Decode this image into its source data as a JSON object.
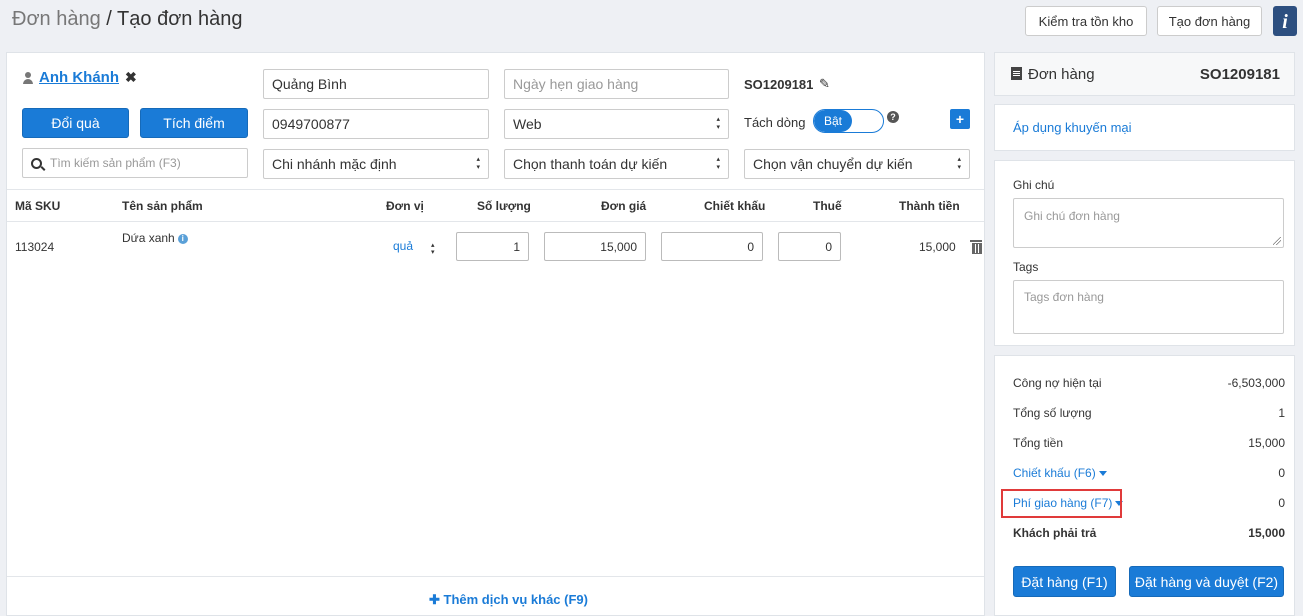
{
  "header": {
    "crumb_parent": "Đơn hàng",
    "crumb_separator": " / ",
    "crumb_current": "Tạo đơn hàng",
    "btn_check_stock": "Kiểm tra tồn kho",
    "btn_create_order": "Tạo đơn hàng",
    "info_glyph": "i"
  },
  "customer": {
    "name": "Anh Khánh",
    "remove_glyph": "✖"
  },
  "buttons": {
    "gift": "Đổi quà",
    "points": "Tích điểm"
  },
  "search": {
    "placeholder": "Tìm kiếm sản phẩm (F3)"
  },
  "fields": {
    "address": "Quảng Bình",
    "phone": "0949700877",
    "branch": "Chi nhánh mặc định",
    "delivery_date_placeholder": "Ngày hẹn giao hàng",
    "source": "Web",
    "payment": "Chọn thanh toán dự kiến",
    "shipping": "Chọn vận chuyển dự kiến"
  },
  "order": {
    "code": "SO1209181",
    "split_label": "Tách dòng",
    "split_state": "Bật",
    "help_glyph": "?",
    "add_glyph": "+"
  },
  "table": {
    "headers": {
      "sku": "Mã SKU",
      "name": "Tên sản phẩm",
      "unit": "Đơn vị",
      "qty": "Số lượng",
      "price": "Đơn giá",
      "discount": "Chiết khấu",
      "tax": "Thuế",
      "total": "Thành tiền"
    },
    "rows": [
      {
        "sku": "113024",
        "name": "Dứa xanh",
        "unit": "quả",
        "qty": "1",
        "price": "15,000",
        "discount": "0",
        "tax": "0",
        "total": "15,000"
      }
    ]
  },
  "footer": {
    "add_service": "✚ Thêm dịch vụ khác (F9)"
  },
  "sidebar": {
    "order_title": "Đơn hàng",
    "order_code": "SO1209181",
    "promo_link": "Áp dụng khuyến mại",
    "note_label": "Ghi chú",
    "note_placeholder": "Ghi chú đơn hàng",
    "tags_label": "Tags",
    "tags_placeholder": "Tags đơn hàng"
  },
  "summary": {
    "debt_label": "Công nợ hiện tại",
    "debt_value": "-6,503,000",
    "qty_label": "Tổng số lượng",
    "qty_value": "1",
    "total_label": "Tổng tiền",
    "total_value": "15,000",
    "discount_label": "Chiết khấu (F6)",
    "discount_value": "0",
    "shipping_label": "Phí giao hàng (F7)",
    "shipping_value": "0",
    "pay_label": "Khách phải trả",
    "pay_value": "15,000"
  },
  "actions": {
    "place_order": "Đặt hàng (F1)",
    "place_approve": "Đặt hàng và duyệt (F2)"
  },
  "colors": {
    "accent": "#1a7bd7",
    "highlight": "#e03a3a"
  }
}
